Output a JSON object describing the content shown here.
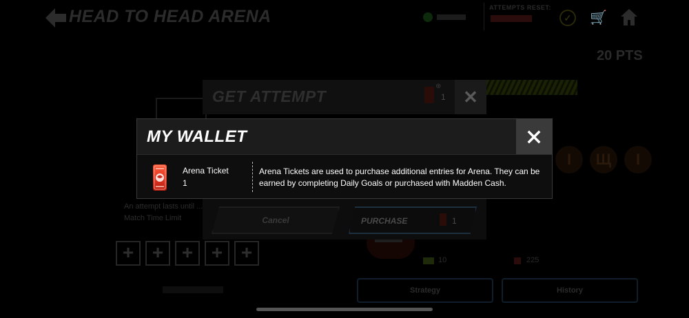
{
  "header": {
    "title": "HEAD TO HEAD ARENA",
    "attempts_reset_label": "ATTEMPTS RESET:"
  },
  "points": "20 PTS",
  "background": {
    "info_text": "An attempt lasts until ... Match Time Limit",
    "plus_slots": [
      "+",
      "+",
      "+",
      "+",
      "+"
    ],
    "medals": [
      "I",
      "Щ",
      "I"
    ],
    "stat_1": "10",
    "stat_2": "225",
    "strategy_label": "Strategy",
    "history_label": "History"
  },
  "get_attempt": {
    "title": "GET ATTEMPT",
    "ticket_plus": "⊕",
    "ticket_count": "1",
    "close_symbol": "✕",
    "cancel_label": "Cancel",
    "purchase_label": "PURCHASE",
    "purchase_cost": "1"
  },
  "wallet": {
    "title": "MY WALLET",
    "close_symbol": "✕",
    "item": {
      "name": "Arena Ticket",
      "count": "1",
      "description": "Arena Tickets are used to purchase additional entries for Arena. They can be earned by completing Daily Goals or purchased with Madden Cash."
    }
  },
  "colors": {
    "background": "#000000",
    "wallet_header": "#1c1c1c",
    "wallet_close_bg": "#3a3a3a",
    "ticket_red": "#e0301e"
  },
  "icons": [
    "back-arrow-icon",
    "coin-icon",
    "check-icon",
    "cart-icon",
    "home-icon",
    "arena-ticket-icon",
    "close-icon"
  ]
}
